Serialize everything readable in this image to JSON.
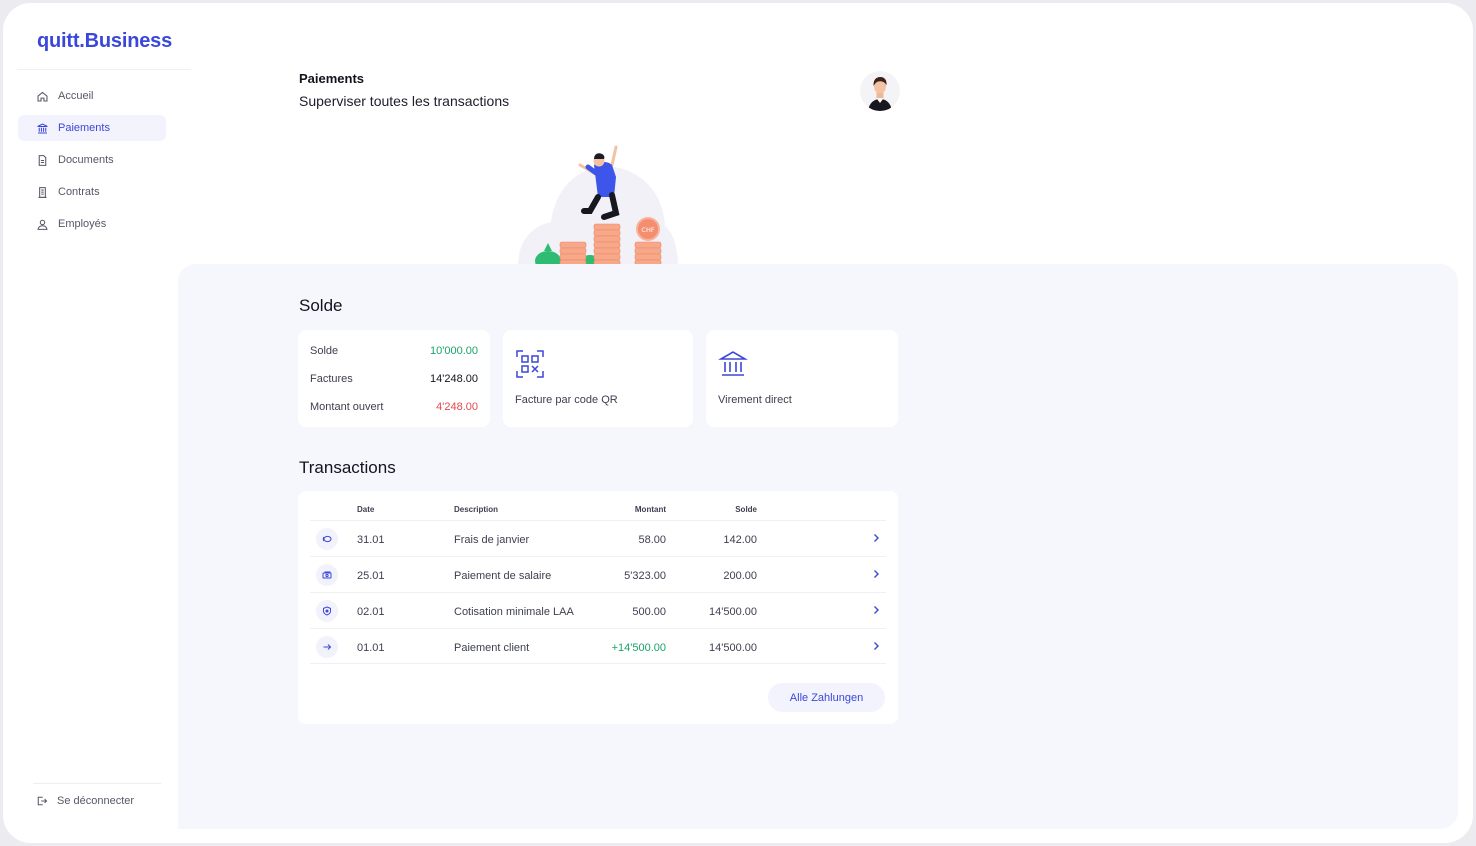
{
  "brand": {
    "logo": "quitt.Business",
    "accent": "#3b47d9"
  },
  "sidebar": {
    "items": [
      {
        "label": "Accueil",
        "icon": "home-icon",
        "active": false
      },
      {
        "label": "Paiements",
        "icon": "bank-icon",
        "active": true
      },
      {
        "label": "Documents",
        "icon": "document-icon",
        "active": false
      },
      {
        "label": "Contrats",
        "icon": "contract-icon",
        "active": false
      },
      {
        "label": "Employés",
        "icon": "user-icon",
        "active": false
      }
    ],
    "logout": {
      "label": "Se déconnecter",
      "icon": "logout-icon"
    }
  },
  "header": {
    "title": "Paiements",
    "subtitle": "Superviser toutes les transactions"
  },
  "balance": {
    "title": "Solde",
    "rows": [
      {
        "label": "Solde",
        "value": "10'000.00",
        "color": "#1aa36a"
      },
      {
        "label": "Factures",
        "value": "14'248.00",
        "color": "#14141f"
      },
      {
        "label": "Montant ouvert",
        "value": "4'248.00",
        "color": "#e5484d"
      }
    ],
    "actions": [
      {
        "label": "Facture par code QR",
        "icon": "qr-code-icon"
      },
      {
        "label": "Virement direct",
        "icon": "bank-icon"
      }
    ]
  },
  "transactions": {
    "title": "Transactions",
    "columns": {
      "date": "Date",
      "description": "Description",
      "amount": "Montant",
      "balance": "Solde"
    },
    "rows": [
      {
        "icon": "coin-icon",
        "date": "31.01",
        "description": "Frais de janvier",
        "amount": "58.00",
        "balance": "142.00",
        "positive": false
      },
      {
        "icon": "banknote-icon",
        "date": "25.01",
        "description": "Paiement de salaire",
        "amount": "5'323.00",
        "balance": "200.00",
        "positive": false
      },
      {
        "icon": "shield-icon",
        "date": "02.01",
        "description": "Cotisation minimale LAA",
        "amount": "500.00",
        "balance": "14'500.00",
        "positive": false
      },
      {
        "icon": "arrow-right-icon",
        "date": "01.01",
        "description": "Paiement client",
        "amount": "+14'500.00",
        "balance": "14'500.00",
        "positive": true
      }
    ],
    "all_button": "Alle Zahlungen"
  },
  "illustration": {
    "coin_label": "CHF"
  }
}
